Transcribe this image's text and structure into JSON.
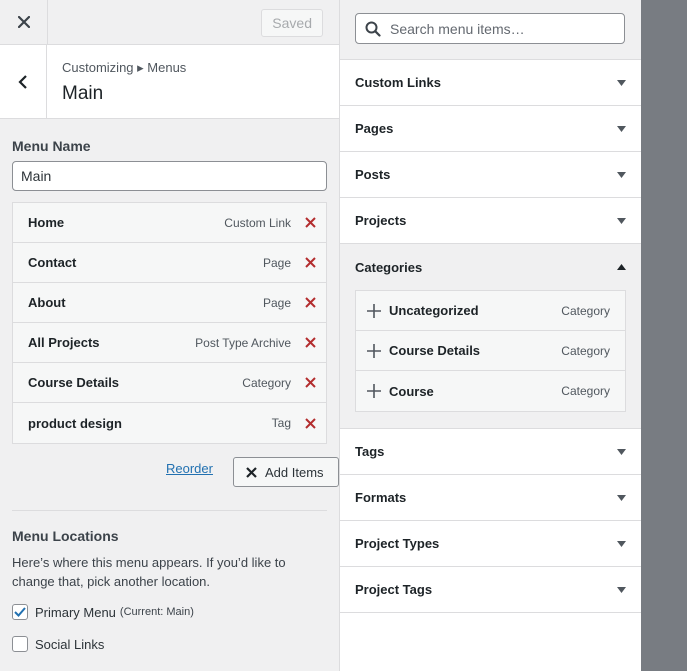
{
  "topbar": {
    "close_icon": "close-icon",
    "saved_label": "Saved"
  },
  "header": {
    "breadcrumb": "Customizing ▸ Menus",
    "title": "Main"
  },
  "menu_name": {
    "label": "Menu Name",
    "value": "Main"
  },
  "menu_items": [
    {
      "title": "Home",
      "type": "Custom Link"
    },
    {
      "title": "Contact",
      "type": "Page"
    },
    {
      "title": "About",
      "type": "Page"
    },
    {
      "title": "All Projects",
      "type": "Post Type Archive"
    },
    {
      "title": "Course Details",
      "type": "Category"
    },
    {
      "title": "product design",
      "type": "Tag"
    }
  ],
  "actions": {
    "reorder_label": "Reorder",
    "add_items_label": "Add Items"
  },
  "locations": {
    "title": "Menu Locations",
    "description": "Here’s where this menu appears. If you’d like to change that, pick another location.",
    "items": [
      {
        "label": "Primary Menu",
        "note": "(Current: Main)",
        "checked": true
      },
      {
        "label": "Social Links",
        "note": "",
        "checked": false
      }
    ]
  },
  "search": {
    "placeholder": "Search menu items…"
  },
  "panels": [
    {
      "label": "Custom Links",
      "open": false
    },
    {
      "label": "Pages",
      "open": false
    },
    {
      "label": "Posts",
      "open": false
    },
    {
      "label": "Projects",
      "open": false
    },
    {
      "label": "Categories",
      "open": true
    },
    {
      "label": "Tags",
      "open": false
    },
    {
      "label": "Formats",
      "open": false
    },
    {
      "label": "Project Types",
      "open": false
    },
    {
      "label": "Project Tags",
      "open": false
    }
  ],
  "categories": [
    {
      "title": "Uncategorized",
      "type": "Category"
    },
    {
      "title": "Course Details",
      "type": "Category"
    },
    {
      "title": "Course",
      "type": "Category"
    }
  ],
  "colors": {
    "accent": "#2271b1",
    "danger": "#b32d2e",
    "sidebar_overlay": "#787c82"
  }
}
